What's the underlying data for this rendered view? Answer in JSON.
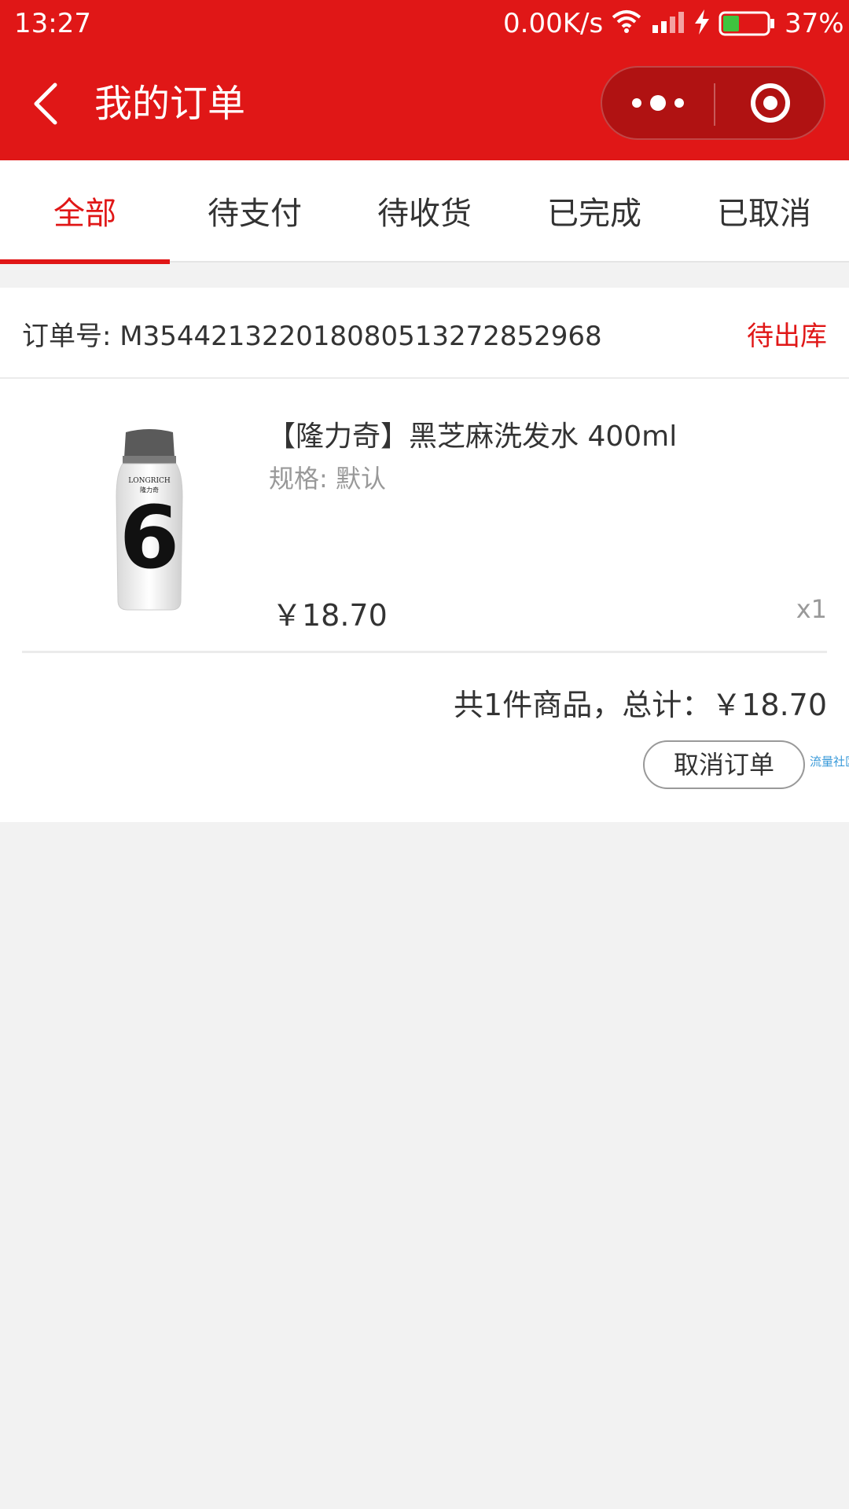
{
  "status_bar": {
    "time": "13:27",
    "network_speed": "0.00K/s",
    "battery_percent": "37%",
    "battery_level": 0.37,
    "icons": [
      "wifi-icon",
      "signal-icon",
      "charging-icon",
      "battery-icon"
    ]
  },
  "title_bar": {
    "title": "我的订单",
    "back_icon": "chevron-left-icon",
    "more_icon": "more-dots-icon",
    "close_icon": "target-circle-icon"
  },
  "tabs": [
    {
      "label": "全部",
      "active": true
    },
    {
      "label": "待支付",
      "active": false
    },
    {
      "label": "待收货",
      "active": false
    },
    {
      "label": "已完成",
      "active": false
    },
    {
      "label": "已取消",
      "active": false
    }
  ],
  "order": {
    "number_label": "订单号: M354421322018080513272852968",
    "status": "待出库",
    "item": {
      "name": "【隆力奇】黑芝麻洗发水 400ml",
      "spec": "规格: 默认",
      "price": "￥18.70",
      "quantity": "x1",
      "image_brand": "LONGRICH",
      "image_brand_cn": "隆力奇",
      "image_numeral": "6"
    },
    "total": "共1件商品，总计：￥18.70",
    "cancel_label": "取消订单",
    "watermark": "流量社区"
  },
  "colors": {
    "accent": "#e01717",
    "capsule": "#b01212",
    "background": "#f2f2f2",
    "text_primary": "#333333",
    "text_secondary": "#999999"
  }
}
